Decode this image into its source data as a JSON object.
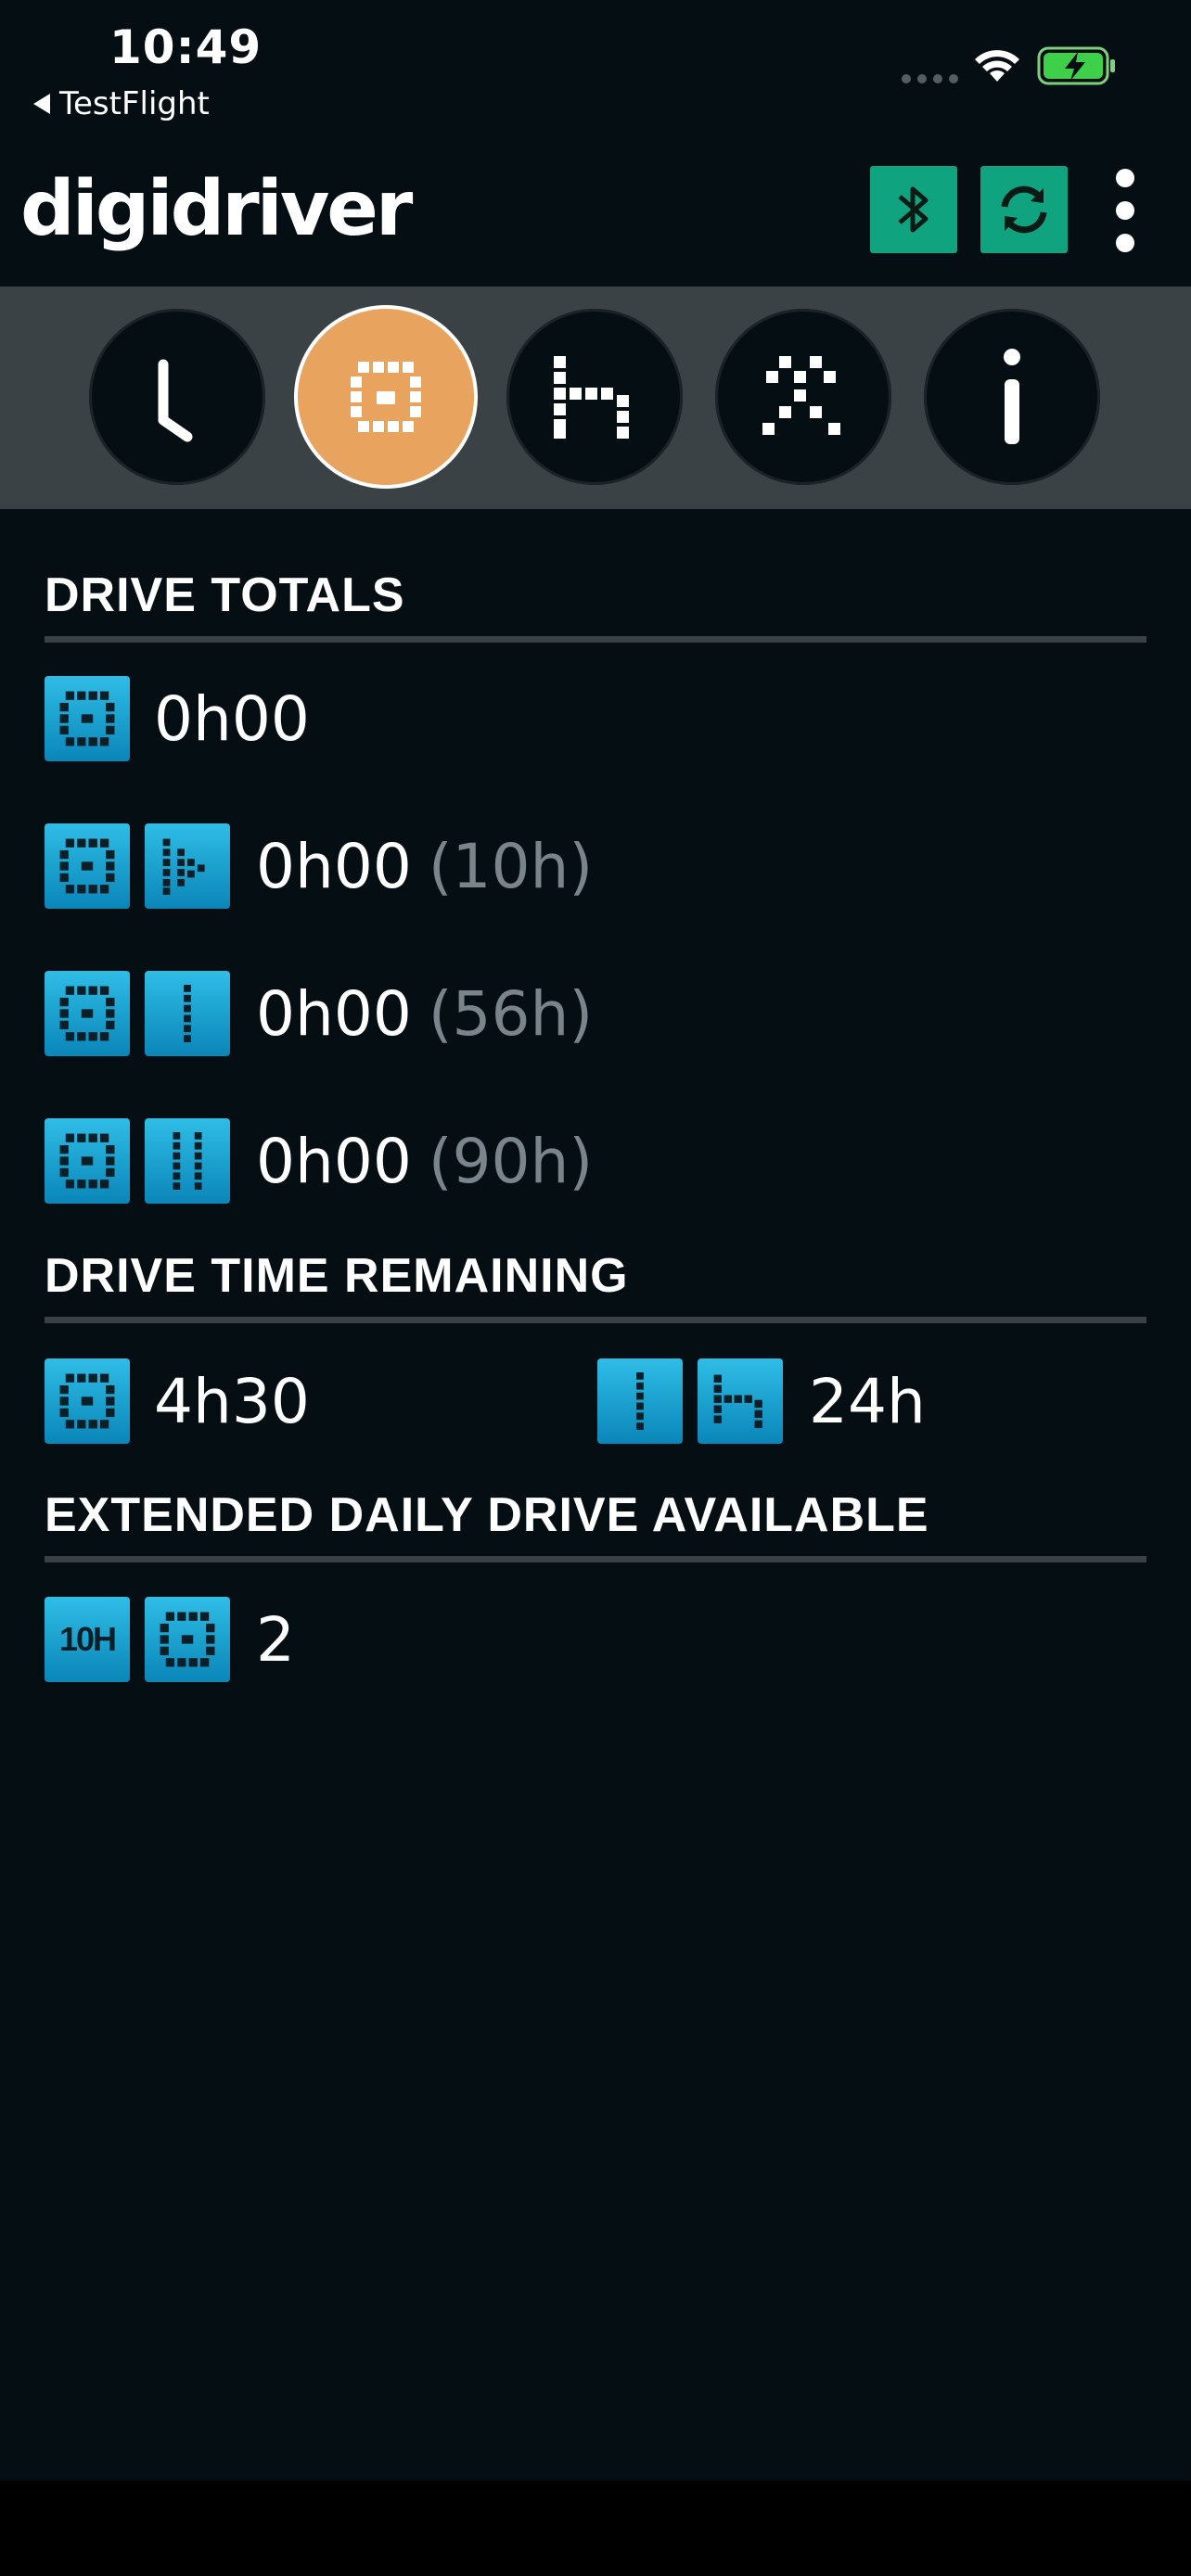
{
  "status_bar": {
    "time": "10:49",
    "back_label": "TestFlight"
  },
  "header": {
    "logo": "digidriver",
    "bluetooth_button": "bluetooth-icon",
    "sync_button": "sync-icon",
    "menu_button": "more-vertical-icon"
  },
  "tabs": [
    {
      "icon": "clock-icon",
      "active": false
    },
    {
      "icon": "steering-wheel-icon",
      "active": true
    },
    {
      "icon": "bed-icon",
      "active": false
    },
    {
      "icon": "work-hammers-icon",
      "active": false
    },
    {
      "icon": "info-icon",
      "active": false
    }
  ],
  "drive_totals": {
    "title": "DRIVE TOTALS",
    "rows": [
      {
        "value": "0h00",
        "limit": ""
      },
      {
        "value": "0h00",
        "limit": "(10h)"
      },
      {
        "value": "0h00",
        "limit": "(56h)"
      },
      {
        "value": "0h00",
        "limit": "(90h)"
      }
    ]
  },
  "drive_time_remaining": {
    "title": "DRIVE TIME REMAINING",
    "drive_value": "4h30",
    "rest_value": "24h"
  },
  "extended_daily_drive": {
    "title": "EXTENDED DAILY DRIVE AVAILABLE",
    "badge_label": "10H",
    "value": "2"
  },
  "colors": {
    "background": "#050e13",
    "accent_green": "#0fa37f",
    "active_tab": "#e8a35e",
    "icon_blue": "#1aa6d6",
    "muted_text": "#7a858b"
  }
}
